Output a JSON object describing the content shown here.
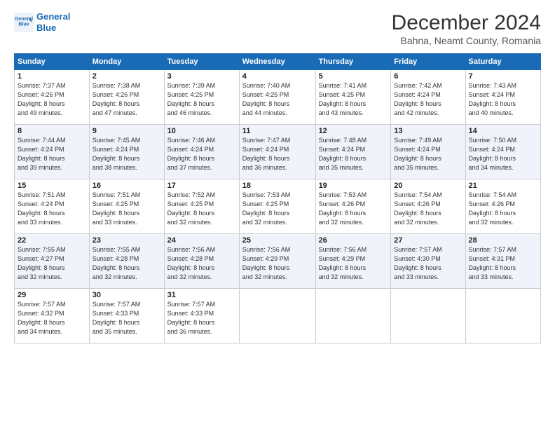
{
  "logo": {
    "line1": "General",
    "line2": "Blue"
  },
  "title": "December 2024",
  "subtitle": "Bahna, Neamt County, Romania",
  "headers": [
    "Sunday",
    "Monday",
    "Tuesday",
    "Wednesday",
    "Thursday",
    "Friday",
    "Saturday"
  ],
  "weeks": [
    [
      {
        "day": "1",
        "info": "Sunrise: 7:37 AM\nSunset: 4:26 PM\nDaylight: 8 hours\nand 49 minutes."
      },
      {
        "day": "2",
        "info": "Sunrise: 7:38 AM\nSunset: 4:26 PM\nDaylight: 8 hours\nand 47 minutes."
      },
      {
        "day": "3",
        "info": "Sunrise: 7:39 AM\nSunset: 4:25 PM\nDaylight: 8 hours\nand 46 minutes."
      },
      {
        "day": "4",
        "info": "Sunrise: 7:40 AM\nSunset: 4:25 PM\nDaylight: 8 hours\nand 44 minutes."
      },
      {
        "day": "5",
        "info": "Sunrise: 7:41 AM\nSunset: 4:25 PM\nDaylight: 8 hours\nand 43 minutes."
      },
      {
        "day": "6",
        "info": "Sunrise: 7:42 AM\nSunset: 4:24 PM\nDaylight: 8 hours\nand 42 minutes."
      },
      {
        "day": "7",
        "info": "Sunrise: 7:43 AM\nSunset: 4:24 PM\nDaylight: 8 hours\nand 40 minutes."
      }
    ],
    [
      {
        "day": "8",
        "info": "Sunrise: 7:44 AM\nSunset: 4:24 PM\nDaylight: 8 hours\nand 39 minutes."
      },
      {
        "day": "9",
        "info": "Sunrise: 7:45 AM\nSunset: 4:24 PM\nDaylight: 8 hours\nand 38 minutes."
      },
      {
        "day": "10",
        "info": "Sunrise: 7:46 AM\nSunset: 4:24 PM\nDaylight: 8 hours\nand 37 minutes."
      },
      {
        "day": "11",
        "info": "Sunrise: 7:47 AM\nSunset: 4:24 PM\nDaylight: 8 hours\nand 36 minutes."
      },
      {
        "day": "12",
        "info": "Sunrise: 7:48 AM\nSunset: 4:24 PM\nDaylight: 8 hours\nand 35 minutes."
      },
      {
        "day": "13",
        "info": "Sunrise: 7:49 AM\nSunset: 4:24 PM\nDaylight: 8 hours\nand 35 minutes."
      },
      {
        "day": "14",
        "info": "Sunrise: 7:50 AM\nSunset: 4:24 PM\nDaylight: 8 hours\nand 34 minutes."
      }
    ],
    [
      {
        "day": "15",
        "info": "Sunrise: 7:51 AM\nSunset: 4:24 PM\nDaylight: 8 hours\nand 33 minutes."
      },
      {
        "day": "16",
        "info": "Sunrise: 7:51 AM\nSunset: 4:25 PM\nDaylight: 8 hours\nand 33 minutes."
      },
      {
        "day": "17",
        "info": "Sunrise: 7:52 AM\nSunset: 4:25 PM\nDaylight: 8 hours\nand 32 minutes."
      },
      {
        "day": "18",
        "info": "Sunrise: 7:53 AM\nSunset: 4:25 PM\nDaylight: 8 hours\nand 32 minutes."
      },
      {
        "day": "19",
        "info": "Sunrise: 7:53 AM\nSunset: 4:26 PM\nDaylight: 8 hours\nand 32 minutes."
      },
      {
        "day": "20",
        "info": "Sunrise: 7:54 AM\nSunset: 4:26 PM\nDaylight: 8 hours\nand 32 minutes."
      },
      {
        "day": "21",
        "info": "Sunrise: 7:54 AM\nSunset: 4:26 PM\nDaylight: 8 hours\nand 32 minutes."
      }
    ],
    [
      {
        "day": "22",
        "info": "Sunrise: 7:55 AM\nSunset: 4:27 PM\nDaylight: 8 hours\nand 32 minutes."
      },
      {
        "day": "23",
        "info": "Sunrise: 7:55 AM\nSunset: 4:28 PM\nDaylight: 8 hours\nand 32 minutes."
      },
      {
        "day": "24",
        "info": "Sunrise: 7:56 AM\nSunset: 4:28 PM\nDaylight: 8 hours\nand 32 minutes."
      },
      {
        "day": "25",
        "info": "Sunrise: 7:56 AM\nSunset: 4:29 PM\nDaylight: 8 hours\nand 32 minutes."
      },
      {
        "day": "26",
        "info": "Sunrise: 7:56 AM\nSunset: 4:29 PM\nDaylight: 8 hours\nand 32 minutes."
      },
      {
        "day": "27",
        "info": "Sunrise: 7:57 AM\nSunset: 4:30 PM\nDaylight: 8 hours\nand 33 minutes."
      },
      {
        "day": "28",
        "info": "Sunrise: 7:57 AM\nSunset: 4:31 PM\nDaylight: 8 hours\nand 33 minutes."
      }
    ],
    [
      {
        "day": "29",
        "info": "Sunrise: 7:57 AM\nSunset: 4:32 PM\nDaylight: 8 hours\nand 34 minutes."
      },
      {
        "day": "30",
        "info": "Sunrise: 7:57 AM\nSunset: 4:33 PM\nDaylight: 8 hours\nand 35 minutes."
      },
      {
        "day": "31",
        "info": "Sunrise: 7:57 AM\nSunset: 4:33 PM\nDaylight: 8 hours\nand 36 minutes."
      },
      null,
      null,
      null,
      null
    ]
  ]
}
